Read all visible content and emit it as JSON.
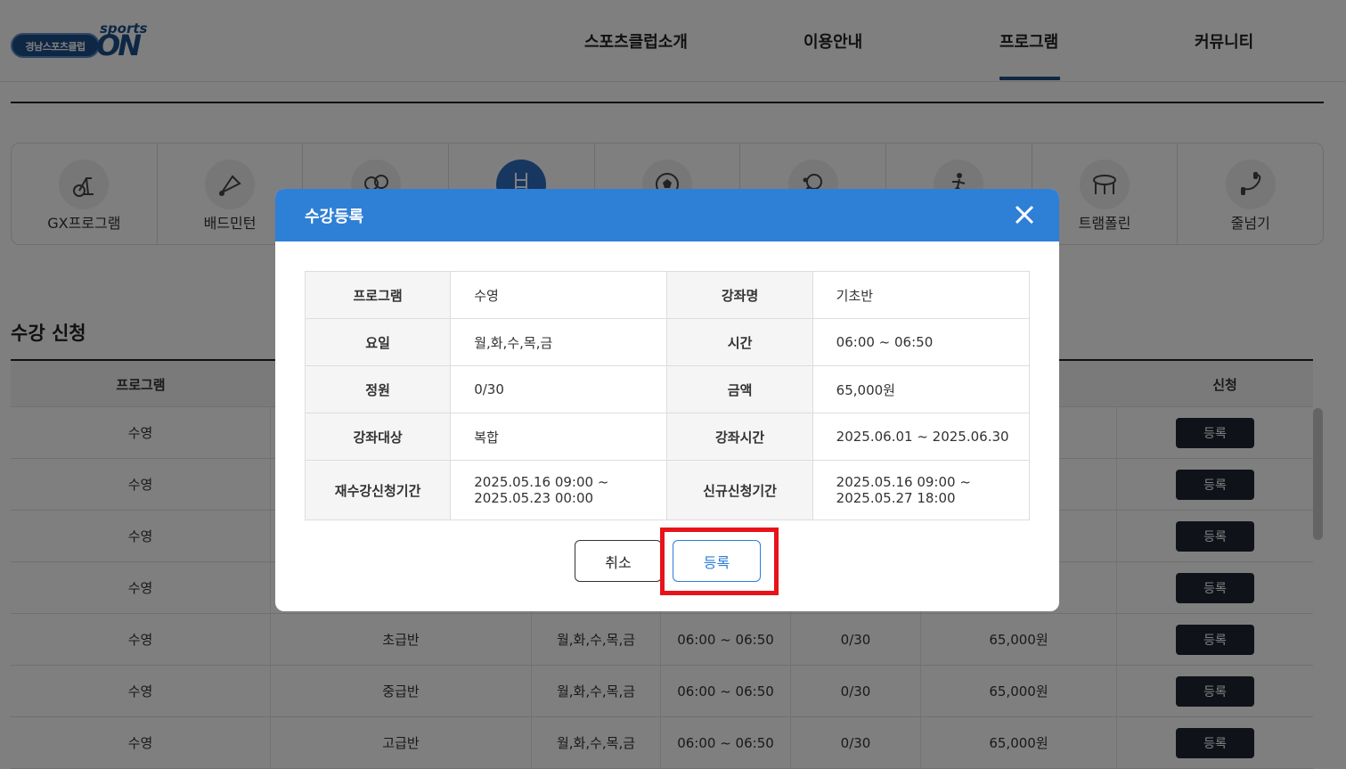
{
  "header": {
    "logo_text": "경남스포츠클럽",
    "logo_sports": "sports",
    "logo_on": "ON",
    "nav": [
      "스포츠클럽소개",
      "이용안내",
      "프로그램",
      "커뮤니티"
    ],
    "active_nav": "프로그램"
  },
  "categories": [
    {
      "label": "GX프로그램",
      "icon": "exercise-bike-icon"
    },
    {
      "label": "배드민턴",
      "icon": "shuttlecock-icon"
    },
    {
      "label": "",
      "icon": "boxing-gloves-icon"
    },
    {
      "label": "",
      "icon": "pool-ladder-icon"
    },
    {
      "label": "",
      "icon": "soccer-ball-icon"
    },
    {
      "label": "",
      "icon": "table-tennis-icon"
    },
    {
      "label": "",
      "icon": "athlete-icon"
    },
    {
      "label": "트램폴린",
      "icon": "trampoline-icon"
    },
    {
      "label": "줄넘기",
      "icon": "jump-rope-icon"
    }
  ],
  "section_title": "수강 신청",
  "list": {
    "headers": {
      "program": "프로그램",
      "apply": "신청"
    },
    "button_label": "등록",
    "rows": [
      {
        "program": "수영",
        "course": "",
        "days": "",
        "time": "",
        "capacity": "",
        "price": ""
      },
      {
        "program": "수영",
        "course": "",
        "days": "",
        "time": "",
        "capacity": "",
        "price": ""
      },
      {
        "program": "수영",
        "course": "",
        "days": "",
        "time": "",
        "capacity": "",
        "price": ""
      },
      {
        "program": "수영",
        "course": "",
        "days": "",
        "time": "",
        "capacity": "",
        "price": ""
      },
      {
        "program": "수영",
        "course": "초급반",
        "days": "월,화,수,목,금",
        "time": "06:00 ~ 06:50",
        "capacity": "0/30",
        "price": "65,000원"
      },
      {
        "program": "수영",
        "course": "중급반",
        "days": "월,화,수,목,금",
        "time": "06:00 ~ 06:50",
        "capacity": "0/30",
        "price": "65,000원"
      },
      {
        "program": "수영",
        "course": "고급반",
        "days": "월,화,수,목,금",
        "time": "06:00 ~ 06:50",
        "capacity": "0/30",
        "price": "65,000원"
      }
    ]
  },
  "modal": {
    "title": "수강등록",
    "rows": [
      {
        "k1": "프로그램",
        "v1": "수영",
        "k2": "강좌명",
        "v2": "기초반"
      },
      {
        "k1": "요일",
        "v1": "월,화,수,목,금",
        "k2": "시간",
        "v2": "06:00 ~ 06:50"
      },
      {
        "k1": "정원",
        "v1": "0/30",
        "k2": "금액",
        "v2": "65,000원"
      },
      {
        "k1": "강좌대상",
        "v1": "복합",
        "k2": "강좌시간",
        "v2": "2025.06.01 ~ 2025.06.30"
      },
      {
        "k1": "재수강신청기간",
        "v1": "2025.05.16 09:00 ~ 2025.05.23 00:00",
        "k2": "신규신청기간",
        "v2": "2025.05.16 09:00 ~ 2025.05.27 18:00"
      }
    ],
    "cancel_label": "취소",
    "submit_label": "등록"
  },
  "colors": {
    "primary": "#2e7fd6",
    "nav_active": "#1f4e86",
    "dark_button": "#1e2733",
    "highlight": "#e8131a"
  }
}
